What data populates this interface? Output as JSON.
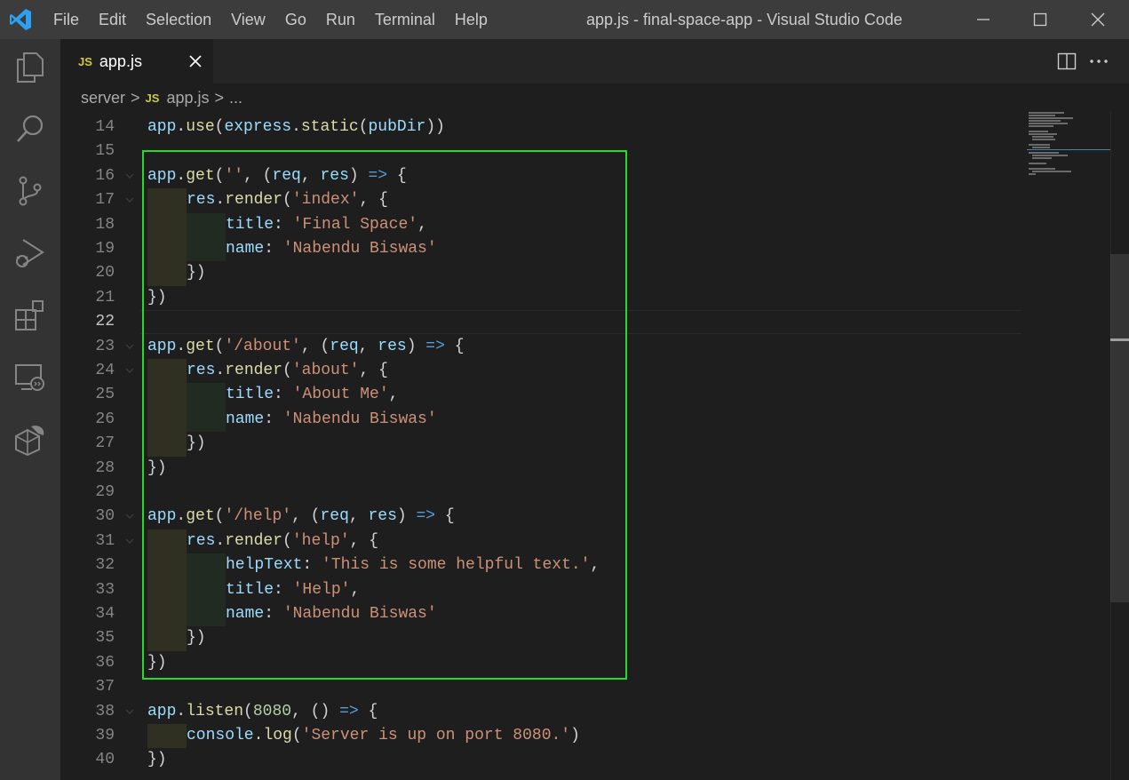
{
  "titlebar": {
    "menu": [
      "File",
      "Edit",
      "Selection",
      "View",
      "Go",
      "Run",
      "Terminal",
      "Help"
    ],
    "window_title": "app.js - final-space-app - Visual Studio Code",
    "controls": [
      "minimize-icon",
      "maximize-icon",
      "close-icon"
    ]
  },
  "activity_bar": [
    "explorer-icon",
    "search-icon",
    "source-control-icon",
    "run-debug-icon",
    "extensions-icon",
    "remote-explorer-icon",
    "docker-icon"
  ],
  "tab": {
    "badge": "JS",
    "label": "app.js",
    "close": "×"
  },
  "editor_actions": [
    "split-editor-icon",
    "more-actions-icon"
  ],
  "breadcrumb": {
    "folder": "server",
    "sep": ">",
    "badge": "JS",
    "file": "app.js",
    "sep2": ">",
    "tail": "..."
  },
  "accent": {
    "highlight_box": "#22dd22",
    "js_badge": "#cbcb41"
  },
  "editor": {
    "current_line": 22,
    "lines": [
      {
        "n": "14"
      },
      {
        "n": "15"
      },
      {
        "n": "16"
      },
      {
        "n": "17"
      },
      {
        "n": "18"
      },
      {
        "n": "19"
      },
      {
        "n": "20"
      },
      {
        "n": "21"
      },
      {
        "n": "22"
      },
      {
        "n": "23"
      },
      {
        "n": "24"
      },
      {
        "n": "25"
      },
      {
        "n": "26"
      },
      {
        "n": "27"
      },
      {
        "n": "28"
      },
      {
        "n": "29"
      },
      {
        "n": "30"
      },
      {
        "n": "31"
      },
      {
        "n": "32"
      },
      {
        "n": "33"
      },
      {
        "n": "34"
      },
      {
        "n": "35"
      },
      {
        "n": "36"
      },
      {
        "n": "37"
      },
      {
        "n": "38"
      },
      {
        "n": "39"
      },
      {
        "n": "40"
      }
    ],
    "code": {
      "l14": [
        "app",
        ".",
        "use",
        "(",
        "express",
        ".",
        "static",
        "(",
        "pubDir",
        "))"
      ],
      "l16": [
        "app",
        ".",
        "get",
        "(",
        "''",
        ", (",
        "req",
        ", ",
        "res",
        ") ",
        "=>",
        " {"
      ],
      "l17": [
        "res",
        ".",
        "render",
        "(",
        "'index'",
        ", {"
      ],
      "l18": [
        "title",
        ": ",
        "'Final Space'",
        ","
      ],
      "l19": [
        "name",
        ": ",
        "'Nabendu Biswas'"
      ],
      "l20": [
        "})"
      ],
      "l21": [
        "})"
      ],
      "l23": [
        "app",
        ".",
        "get",
        "(",
        "'/about'",
        ", (",
        "req",
        ", ",
        "res",
        ") ",
        "=>",
        " {"
      ],
      "l24": [
        "res",
        ".",
        "render",
        "(",
        "'about'",
        ", {"
      ],
      "l25": [
        "title",
        ": ",
        "'About Me'",
        ","
      ],
      "l26": [
        "name",
        ": ",
        "'Nabendu Biswas'"
      ],
      "l27": [
        "})"
      ],
      "l28": [
        "})"
      ],
      "l30": [
        "app",
        ".",
        "get",
        "(",
        "'/help'",
        ", (",
        "req",
        ", ",
        "res",
        ") ",
        "=>",
        " {"
      ],
      "l31": [
        "res",
        ".",
        "render",
        "(",
        "'help'",
        ", {"
      ],
      "l32": [
        "helpText",
        ": ",
        "'This is some helpful text.'",
        ","
      ],
      "l33": [
        "title",
        ": ",
        "'Help'",
        ","
      ],
      "l34": [
        "name",
        ": ",
        "'Nabendu Biswas'"
      ],
      "l35": [
        "})"
      ],
      "l36": [
        "})"
      ],
      "l38": [
        "app",
        ".",
        "listen",
        "(",
        "8080",
        ", () ",
        "=>",
        " {"
      ],
      "l39": [
        "console",
        ".",
        "log",
        "(",
        "'Server is up on port 8080.'",
        ")"
      ],
      "l40": [
        "})"
      ]
    }
  }
}
